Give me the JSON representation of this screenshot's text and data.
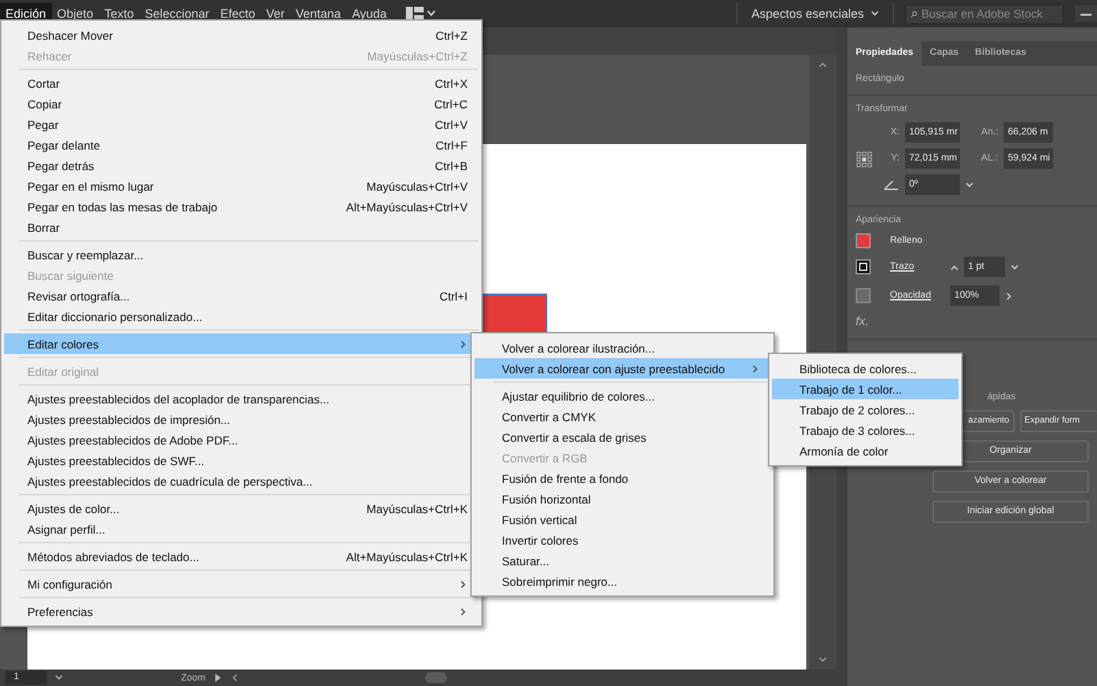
{
  "menubar": {
    "items": [
      {
        "label": "Edición",
        "selected": true
      },
      {
        "label": "Objeto",
        "selected": false
      },
      {
        "label": "Texto",
        "selected": false
      },
      {
        "label": "Seleccionar",
        "selected": false
      },
      {
        "label": "Efecto",
        "selected": false
      },
      {
        "label": "Ver",
        "selected": false
      },
      {
        "label": "Ventana",
        "selected": false
      },
      {
        "label": "Ayuda",
        "selected": false
      }
    ],
    "workspace": "Aspectos esenciales",
    "search": {
      "placeholder": "Buscar en Adobe Stock"
    }
  },
  "edit_menu": {
    "groups": [
      [
        {
          "label": "Deshacer Mover",
          "shortcut": "Ctrl+Z",
          "disabled": false,
          "selected": false,
          "submenu": false
        },
        {
          "label": "Rehacer",
          "shortcut": "Mayúsculas+Ctrl+Z",
          "disabled": true,
          "selected": false,
          "submenu": false
        }
      ],
      [
        {
          "label": "Cortar",
          "shortcut": "Ctrl+X",
          "disabled": false,
          "selected": false,
          "submenu": false
        },
        {
          "label": "Copiar",
          "shortcut": "Ctrl+C",
          "disabled": false,
          "selected": false,
          "submenu": false
        },
        {
          "label": "Pegar",
          "shortcut": "Ctrl+V",
          "disabled": false,
          "selected": false,
          "submenu": false
        },
        {
          "label": "Pegar delante",
          "shortcut": "Ctrl+F",
          "disabled": false,
          "selected": false,
          "submenu": false
        },
        {
          "label": "Pegar detrás",
          "shortcut": "Ctrl+B",
          "disabled": false,
          "selected": false,
          "submenu": false
        },
        {
          "label": "Pegar en el mismo lugar",
          "shortcut": "Mayúsculas+Ctrl+V",
          "disabled": false,
          "selected": false,
          "submenu": false
        },
        {
          "label": "Pegar en todas las mesas de trabajo",
          "shortcut": "Alt+Mayúsculas+Ctrl+V",
          "disabled": false,
          "selected": false,
          "submenu": false
        },
        {
          "label": "Borrar",
          "disabled": false,
          "selected": false,
          "submenu": false
        }
      ],
      [
        {
          "label": "Buscar y reemplazar...",
          "disabled": false,
          "selected": false,
          "submenu": false
        },
        {
          "label": "Buscar siguiente",
          "disabled": true,
          "selected": false,
          "submenu": false
        },
        {
          "label": "Revisar ortografía...",
          "shortcut": "Ctrl+I",
          "disabled": false,
          "selected": false,
          "submenu": false
        },
        {
          "label": "Editar diccionario personalizado...",
          "disabled": false,
          "selected": false,
          "submenu": false
        }
      ],
      [
        {
          "label": "Editar colores",
          "disabled": false,
          "selected": true,
          "submenu": true
        }
      ],
      [
        {
          "label": "Editar original",
          "disabled": true,
          "selected": false,
          "submenu": false
        }
      ],
      [
        {
          "label": "Ajustes preestablecidos del acoplador de transparencias...",
          "disabled": false,
          "selected": false,
          "submenu": false
        },
        {
          "label": "Ajustes preestablecidos de impresión...",
          "disabled": false,
          "selected": false,
          "submenu": false
        },
        {
          "label": "Ajustes preestablecidos de Adobe PDF...",
          "disabled": false,
          "selected": false,
          "submenu": false
        },
        {
          "label": "Ajustes preestablecidos de SWF...",
          "disabled": false,
          "selected": false,
          "submenu": false
        },
        {
          "label": "Ajustes preestablecidos de cuadrícula de perspectiva...",
          "disabled": false,
          "selected": false,
          "submenu": false
        }
      ],
      [
        {
          "label": "Ajustes de color...",
          "shortcut": "Mayúsculas+Ctrl+K",
          "disabled": false,
          "selected": false,
          "submenu": false
        },
        {
          "label": "Asignar perfil...",
          "disabled": false,
          "selected": false,
          "submenu": false
        }
      ],
      [
        {
          "label": "Métodos abreviados de teclado...",
          "shortcut": "Alt+Mayúsculas+Ctrl+K",
          "disabled": false,
          "selected": false,
          "submenu": false
        }
      ],
      [
        {
          "label": "Mi configuración",
          "disabled": false,
          "selected": false,
          "submenu": true
        }
      ],
      [
        {
          "label": "Preferencias",
          "disabled": false,
          "selected": false,
          "submenu": true
        }
      ]
    ]
  },
  "colors_menu": {
    "groups": [
      [
        {
          "label": "Volver a colorear ilustración...",
          "disabled": false,
          "selected": false,
          "submenu": false
        },
        {
          "label": "Volver a colorear con ajuste preestablecido",
          "disabled": false,
          "selected": true,
          "submenu": true
        }
      ],
      [
        {
          "label": "Ajustar equilibrio de colores...",
          "disabled": false,
          "selected": false,
          "submenu": false
        },
        {
          "label": "Convertir a CMYK",
          "disabled": false,
          "selected": false,
          "submenu": false
        },
        {
          "label": "Convertir a escala de grises",
          "disabled": false,
          "selected": false,
          "submenu": false
        },
        {
          "label": "Convertir a RGB",
          "disabled": true,
          "selected": false,
          "submenu": false
        },
        {
          "label": "Fusión de frente a fondo",
          "disabled": false,
          "selected": false,
          "submenu": false
        },
        {
          "label": "Fusión horizontal",
          "disabled": false,
          "selected": false,
          "submenu": false
        },
        {
          "label": "Fusión vertical",
          "disabled": false,
          "selected": false,
          "submenu": false
        },
        {
          "label": "Invertir colores",
          "disabled": false,
          "selected": false,
          "submenu": false
        },
        {
          "label": "Saturar...",
          "disabled": false,
          "selected": false,
          "submenu": false
        },
        {
          "label": "Sobreimprimir negro...",
          "disabled": false,
          "selected": false,
          "submenu": false
        }
      ]
    ]
  },
  "preset_menu": {
    "groups": [
      [
        {
          "label": "Biblioteca de colores...",
          "disabled": false,
          "selected": false,
          "submenu": false
        },
        {
          "label": "Trabajo de 1 color...",
          "disabled": false,
          "selected": true,
          "submenu": false
        },
        {
          "label": "Trabajo de 2 colores...",
          "disabled": false,
          "selected": false,
          "submenu": false
        },
        {
          "label": "Trabajo de 3 colores...",
          "disabled": false,
          "selected": false,
          "submenu": false
        },
        {
          "label": "Armonía de color",
          "disabled": false,
          "selected": false,
          "submenu": false
        }
      ]
    ]
  },
  "properties_panel": {
    "tabs": [
      {
        "label": "Propiedades",
        "selected": true
      },
      {
        "label": "Capas",
        "selected": false
      },
      {
        "label": "Bibliotecas",
        "selected": false
      }
    ],
    "object_type": "Rectángulo",
    "transform": {
      "title": "Transformar",
      "x_label": "X:",
      "x": "105,915 mr",
      "width_label": "An.:",
      "width": "66,206 m",
      "y_label": "Y:",
      "y": "72,015 mm",
      "height_label": "AL.:",
      "height": "59,924 mi",
      "angle": "0º"
    },
    "appearance": {
      "title": "Apariencia",
      "fill_label": "Relleno",
      "stroke_label": "Trazo",
      "stroke_weight": "1 pt",
      "opacity_label": "Opacidad",
      "opacity": "100%",
      "effects": "fx."
    },
    "quick_actions": {
      "title": "ápidas",
      "buttons": [
        {
          "label": "azamiento"
        },
        {
          "label": "Expandir form"
        }
      ],
      "wide_buttons": [
        {
          "label": "Organizar"
        },
        {
          "label": "Volver a colorear"
        },
        {
          "label": "Iniciar edición global"
        }
      ]
    }
  },
  "status_bar": {
    "artboard": "1",
    "zoom_label": "Zoom"
  }
}
